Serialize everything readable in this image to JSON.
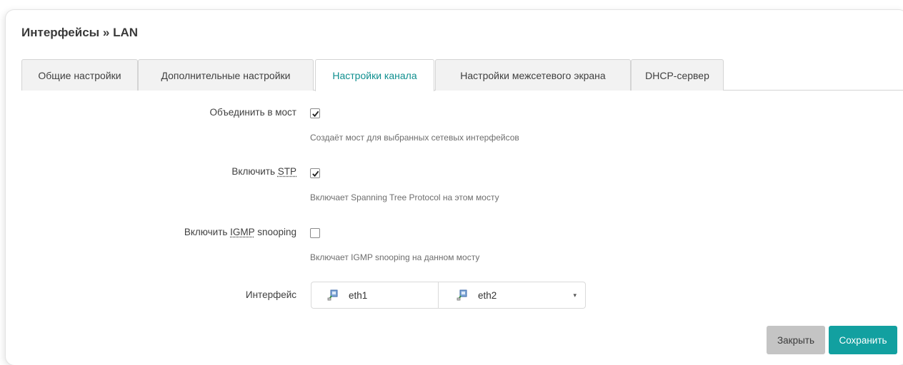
{
  "page": {
    "title": "Интерфейсы » LAN"
  },
  "tabs": [
    {
      "label": "Общие настройки",
      "active": false
    },
    {
      "label": "Дополнительные настройки",
      "active": false
    },
    {
      "label": "Настройки канала",
      "active": true
    },
    {
      "label": "Настройки межсетевого экрана",
      "active": false
    },
    {
      "label": "DHCP-сервер",
      "active": false
    }
  ],
  "form": {
    "bridge": {
      "label": "Объединить в мост",
      "checked": true,
      "help": "Создаёт мост для выбранных сетевых интерфейсов"
    },
    "stp": {
      "label_prefix": "Включить ",
      "label_abbr": "STP",
      "checked": true,
      "help": "Включает Spanning Tree Protocol на этом мосту"
    },
    "igmp": {
      "label_prefix": "Включить ",
      "label_abbr": "IGMP",
      "label_suffix": " snooping",
      "checked": false,
      "help": "Включает IGMP snooping на данном мосту"
    },
    "interface": {
      "label": "Интерфейс",
      "selected": [
        "eth1",
        "eth2"
      ],
      "icon": "network-port-icon",
      "caret": "▾"
    }
  },
  "actions": {
    "close_label": "Закрыть",
    "save_label": "Сохранить"
  },
  "colors": {
    "accent": "#12a0a0",
    "active_tab_text": "#0f8f8f",
    "close_button": "#c4c4c4"
  }
}
